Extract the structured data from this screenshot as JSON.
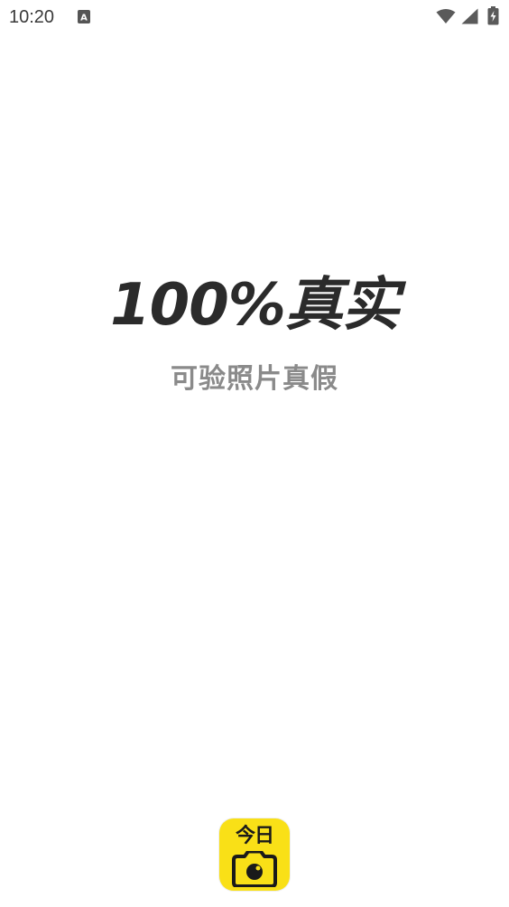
{
  "status_bar": {
    "time": "10:20",
    "notification_icon": "a-notification-icon",
    "wifi_icon": "wifi-icon",
    "signal_icon": "cell-signal-icon",
    "battery_icon": "battery-charging-icon"
  },
  "splash": {
    "headline": "100%真实",
    "subtitle": "可验照片真假"
  },
  "app_logo": {
    "text": "今日",
    "icon": "camera-icon",
    "background_color": "#f9e017"
  }
}
